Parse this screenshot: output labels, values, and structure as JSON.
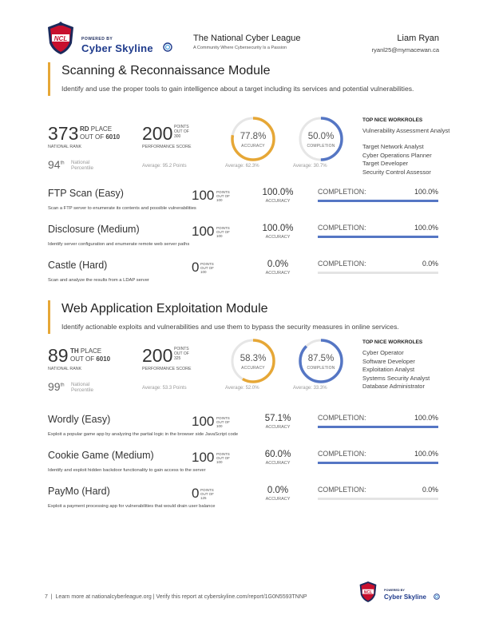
{
  "header": {
    "powered_by": "POWERED BY",
    "brand": "Cyber Skyline",
    "org_title": "The National Cyber League",
    "org_subtitle": "A Community Where Cybersecurity Is a Passion",
    "user_name": "Liam Ryan",
    "user_email": "ryanl25@mymacewan.ca",
    "brand_color": "#1f3b8c",
    "logo_color": "#c8102e"
  },
  "modules": [
    {
      "title": "Scanning & Reconnaissance Module",
      "description": "Identify and use the proper tools to gain intelligence about a target including its services and potential vulnerabilities.",
      "rank": {
        "value": "373",
        "ordinal": "RD",
        "place_label": "PLACE",
        "out_of_label": "OUT OF",
        "out_of": "6010",
        "caption": "NATIONAL RANK"
      },
      "percentile": {
        "value": "94",
        "ordinal": "th",
        "label": "National Percentile"
      },
      "score": {
        "value": "200",
        "points_label": "POINTS",
        "out_of_label": "OUT OF",
        "out_of": "300",
        "caption": "PERFORMANCE SCORE",
        "average": "Average: 95.2 Points"
      },
      "accuracy": {
        "value": "77.8%",
        "label": "ACCURACY",
        "average": "Average: 62.3%",
        "fraction": 0.778
      },
      "completion": {
        "value": "50.0%",
        "label": "COMPLETION",
        "average": "Average: 30.7%",
        "fraction": 0.5
      },
      "workroles_heading": "TOP NICE WORKROLES",
      "workroles": [
        "Vulnerability Assessment Analyst",
        "Target Network Analyst",
        "Cyber Operations Planner",
        "Target Developer",
        "Security Control Assessor"
      ],
      "challenges": [
        {
          "title": "FTP Scan (Easy)",
          "description": "Scan a FTP server to enumerate its contents and possible vulnerabilities",
          "points": "100",
          "points_label": "POINTS",
          "out_of_label": "OUT OF",
          "out_of": "100",
          "accuracy": "100.0%",
          "accuracy_label": "ACCURACY",
          "completion_label": "COMPLETION:",
          "completion": "100.0%",
          "completion_fraction": 1.0
        },
        {
          "title": "Disclosure (Medium)",
          "description": "Identify server configuration and enumerate remote web server paths",
          "points": "100",
          "points_label": "POINTS",
          "out_of_label": "OUT OF",
          "out_of": "100",
          "accuracy": "100.0%",
          "accuracy_label": "ACCURACY",
          "completion_label": "COMPLETION:",
          "completion": "100.0%",
          "completion_fraction": 1.0
        },
        {
          "title": "Castle (Hard)",
          "description": "Scan and analyze the results from a LDAP server",
          "points": "0",
          "points_label": "POINTS",
          "out_of_label": "OUT OF",
          "out_of": "100",
          "accuracy": "0.0%",
          "accuracy_label": "ACCURACY",
          "completion_label": "COMPLETION:",
          "completion": "0.0%",
          "completion_fraction": 0.0
        }
      ]
    },
    {
      "title": "Web Application Exploitation Module",
      "description": "Identify actionable exploits and vulnerabilities and use them to bypass the security measures in online services.",
      "rank": {
        "value": "89",
        "ordinal": "TH",
        "place_label": "PLACE",
        "out_of_label": "OUT OF",
        "out_of": "6010",
        "caption": "NATIONAL RANK"
      },
      "percentile": {
        "value": "99",
        "ordinal": "th",
        "label": "National Percentile"
      },
      "score": {
        "value": "200",
        "points_label": "POINTS",
        "out_of_label": "OUT OF",
        "out_of": "325",
        "caption": "PERFORMANCE SCORE",
        "average": "Average: 53.3 Points"
      },
      "accuracy": {
        "value": "58.3%",
        "label": "ACCURACY",
        "average": "Average: 52.0%",
        "fraction": 0.583
      },
      "completion": {
        "value": "87.5%",
        "label": "COMPLETION",
        "average": "Average: 33.3%",
        "fraction": 0.875
      },
      "workroles_heading": "TOP NICE WORKROLES",
      "workroles": [
        "Cyber Operator",
        "Software Developer",
        "Exploitation Analyst",
        "Systems Security Analyst",
        "Database Administrator"
      ],
      "challenges": [
        {
          "title": "Wordly (Easy)",
          "description": "Exploit a popular game app by analyzing the partial logic in the browser side JavaScript code",
          "points": "100",
          "points_label": "POINTS",
          "out_of_label": "OUT OF",
          "out_of": "100",
          "accuracy": "57.1%",
          "accuracy_label": "ACCURACY",
          "completion_label": "COMPLETION:",
          "completion": "100.0%",
          "completion_fraction": 1.0
        },
        {
          "title": "Cookie Game (Medium)",
          "description": "Identify and exploit hidden backdoor functionality to gain access to the server",
          "points": "100",
          "points_label": "POINTS",
          "out_of_label": "OUT OF",
          "out_of": "100",
          "accuracy": "60.0%",
          "accuracy_label": "ACCURACY",
          "completion_label": "COMPLETION:",
          "completion": "100.0%",
          "completion_fraction": 1.0
        },
        {
          "title": "PayMo (Hard)",
          "description": "Exploit a payment processing app for vulnerabilities that would drain user balance",
          "points": "0",
          "points_label": "POINTS",
          "out_of_label": "OUT OF",
          "out_of": "125",
          "accuracy": "0.0%",
          "accuracy_label": "ACCURACY",
          "completion_label": "COMPLETION:",
          "completion": "0.0%",
          "completion_fraction": 0.0
        }
      ]
    }
  ],
  "colors": {
    "accuracy_ring": "#e6a736",
    "completion_ring": "#5576c4",
    "ring_track": "#e6e6e6",
    "completion_bar": "#5576c4"
  },
  "footer": {
    "page_number": "7",
    "text": "Learn more at nationalcyberleague.org  |  Verify this report at cyberskyline.com/report/1G0N5593TNNP",
    "powered_by": "POWERED BY",
    "brand": "Cyber Skyline"
  }
}
